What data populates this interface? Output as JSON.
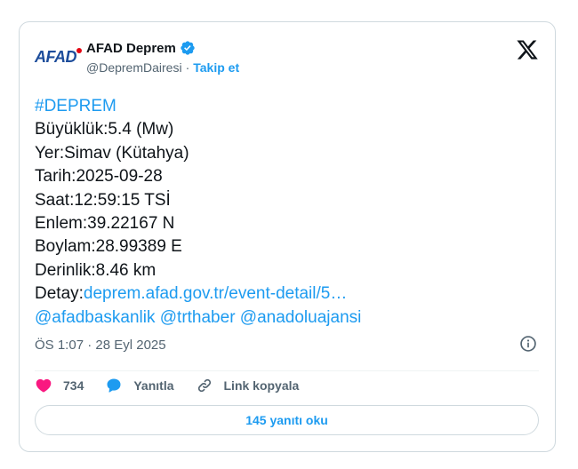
{
  "author": {
    "logo_text": "AFAD",
    "display_name": "AFAD Deprem",
    "handle": "@DepremDairesi",
    "separator": "·",
    "follow_label": "Takip et"
  },
  "tweet": {
    "hashtag": "#DEPREM",
    "lines": [
      "Büyüklük:5.4 (Mw)",
      "Yer:Simav (Kütahya)",
      "Tarih:2025-09-28",
      "Saat:12:59:15 TSİ",
      "Enlem:39.22167 N",
      "Boylam:28.99389 E",
      "Derinlik:8.46 km"
    ],
    "detail_prefix": "Detay:",
    "detail_link": "deprem.afad.gov.tr/event-detail/5…",
    "mentions": "@afadbaskanlik @trthaber @anadoluajansi"
  },
  "meta": {
    "timestamp": "ÖS 1:07 · 28 Eyl 2025"
  },
  "actions": {
    "like_count": "734",
    "reply_label": "Yanıtla",
    "copy_link_label": "Link kopyala"
  },
  "read_replies_label": "145 yanıtı oku",
  "colors": {
    "accent": "#1d9bf0",
    "like": "#f91880",
    "logo_blue": "#1d4d9b",
    "logo_red": "#e30613"
  }
}
